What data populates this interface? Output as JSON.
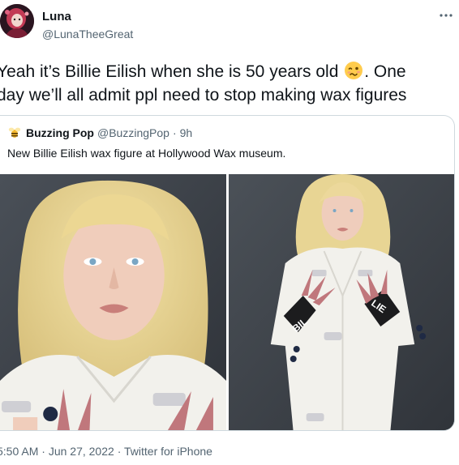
{
  "author": {
    "name": "Luna",
    "handle": "@LunaTheeGreat"
  },
  "tweet": {
    "text_line1": "Yeah it’s Billie Eilish when she is 50 years old",
    "text_line1_end": ". One",
    "text_line2": "day we’ll all admit ppl need to stop making wax figures",
    "emoji": "woozy-face-emoji"
  },
  "quote": {
    "name": "Buzzing Pop",
    "handle": "@BuzzingPop",
    "separator": "·",
    "time": "9h",
    "text": "New Billie Eilish wax figure at Hollywood Wax museum.",
    "images": [
      {
        "alt_icon": "wax-figure-closeup-photo"
      },
      {
        "alt_icon": "wax-figure-fullbody-photo"
      }
    ],
    "hand_text_left": "BIL",
    "hand_text_right": "LIE"
  },
  "footer": {
    "time": "5:50 AM",
    "separator": "·",
    "date": "Jun 27, 2022",
    "source": "Twitter for iPhone"
  },
  "colors": {
    "text_primary": "#0f1419",
    "text_secondary": "#536471",
    "border": "#cfd9de",
    "hair": "#ead89c",
    "coat": "#f2f1ec"
  }
}
